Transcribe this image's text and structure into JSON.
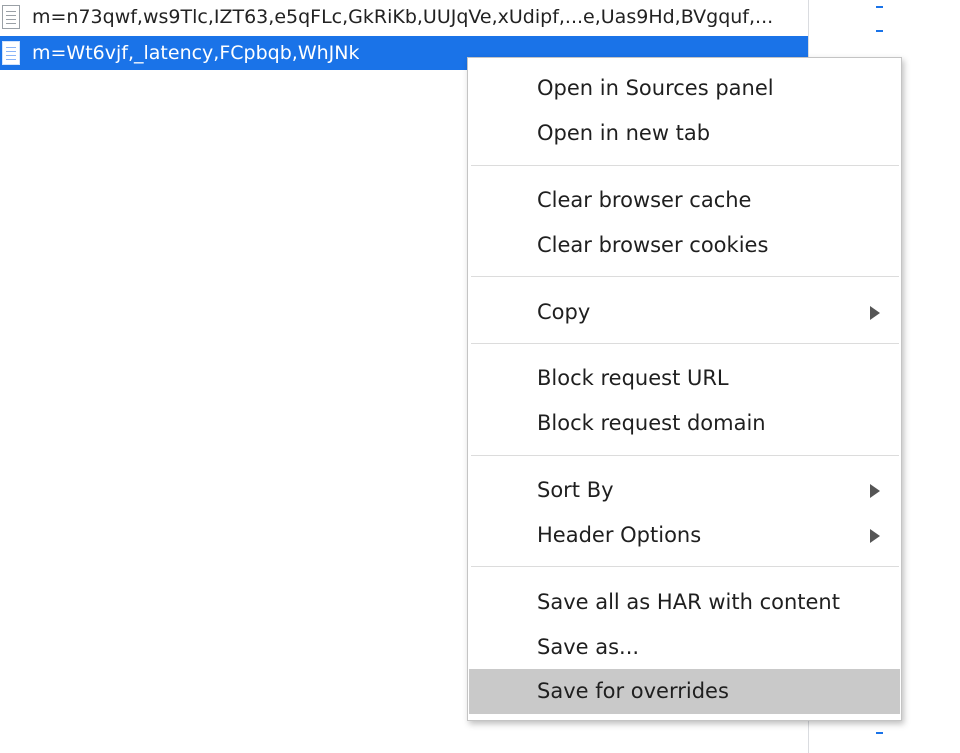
{
  "requests": [
    {
      "name": "m=n73qwf,ws9Tlc,IZT63,e5qFLc,GkRiKb,UUJqVe,xUdipf,...e,Uas9Hd,BVgquf,...",
      "icon": "document-icon",
      "selected": false
    },
    {
      "name": "m=Wt6vjf,_latency,FCpbqb,WhJNk",
      "icon": "document-icon",
      "selected": true
    }
  ],
  "context_menu": {
    "items": [
      {
        "label": "Open in Sources panel",
        "submenu": false,
        "highlighted": false
      },
      {
        "label": "Open in new tab",
        "submenu": false,
        "highlighted": false
      },
      {
        "label": "Clear browser cache",
        "submenu": false,
        "highlighted": false
      },
      {
        "label": "Clear browser cookies",
        "submenu": false,
        "highlighted": false
      },
      {
        "label": "Copy",
        "submenu": true,
        "highlighted": false
      },
      {
        "label": "Block request URL",
        "submenu": false,
        "highlighted": false
      },
      {
        "label": "Block request domain",
        "submenu": false,
        "highlighted": false
      },
      {
        "label": "Sort By",
        "submenu": true,
        "highlighted": false
      },
      {
        "label": "Header Options",
        "submenu": true,
        "highlighted": false
      },
      {
        "label": "Save all as HAR with content",
        "submenu": false,
        "highlighted": false
      },
      {
        "label": "Save as...",
        "submenu": false,
        "highlighted": false
      },
      {
        "label": "Save for overrides",
        "submenu": false,
        "highlighted": true
      }
    ]
  },
  "colors": {
    "selection": "#1a73e8",
    "menu_highlight": "#c9c9c9"
  }
}
